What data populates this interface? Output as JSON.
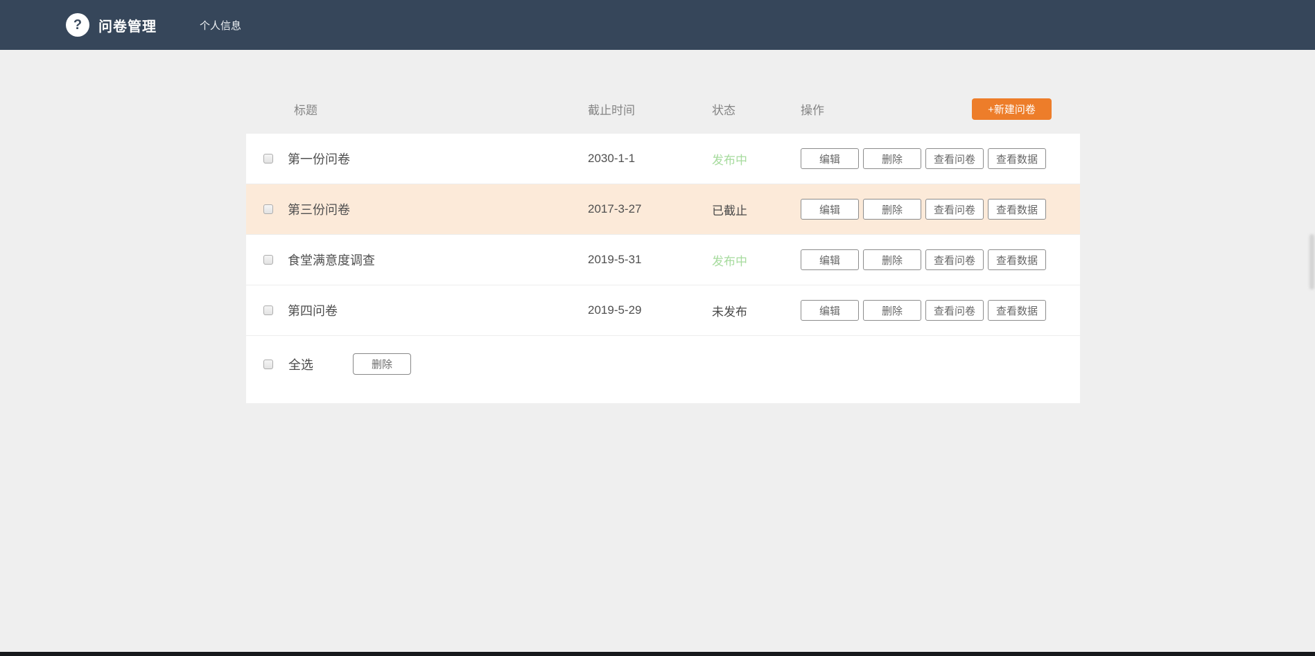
{
  "navbar": {
    "help_glyph": "?",
    "title": "问卷管理",
    "menu_item": "个人信息"
  },
  "table": {
    "headers": {
      "title": "标题",
      "deadline": "截止时间",
      "status": "状态",
      "actions": "操作"
    },
    "new_button_label": "+新建问卷",
    "action_labels": [
      "编辑",
      "删除",
      "查看问卷",
      "查看数据"
    ],
    "rows": [
      {
        "title": "第一份问卷",
        "deadline": "2030-1-1",
        "status": "发布中",
        "status_type": "published",
        "highlight": false
      },
      {
        "title": "第三份问卷",
        "deadline": "2017-3-27",
        "status": "已截止",
        "status_type": "expired",
        "highlight": true
      },
      {
        "title": "食堂满意度调查",
        "deadline": "2019-5-31",
        "status": "发布中",
        "status_type": "published",
        "highlight": false
      },
      {
        "title": "第四问卷",
        "deadline": "2019-5-29",
        "status": "未发布",
        "status_type": "unpublished",
        "highlight": false
      }
    ],
    "footer": {
      "select_all_label": "全选",
      "delete_button_label": "删除"
    }
  },
  "colors": {
    "navbar_bg": "#36465a",
    "page_bg": "#efefef",
    "accent_orange": "#ed7d2a",
    "status_green": "#a6db9d",
    "highlight_row_bg": "#fcead9"
  }
}
